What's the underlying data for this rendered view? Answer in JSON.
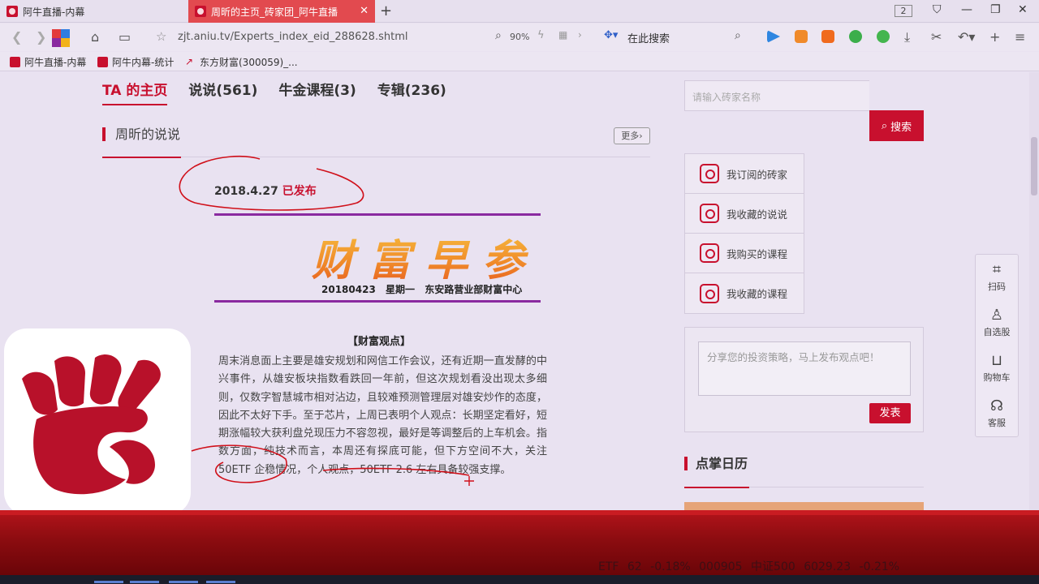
{
  "browser": {
    "tabs": [
      {
        "label": "阿牛直播-内幕",
        "active": false
      },
      {
        "label": "周昕的主页_砖家团_阿牛直播",
        "active": true
      }
    ],
    "tab_count": "2",
    "url": "zjt.aniu.tv/Experts_index_eid_288628.shtml",
    "zoom": "90%",
    "search_engine_label": "在此搜索",
    "bookmarks": [
      "阿牛直播-内幕",
      "阿牛内幕-统计",
      "东方财富(300059)_..."
    ]
  },
  "nav": {
    "tabs": [
      "TA 的主页",
      "说说(561)",
      "牛金课程(3)",
      "专辑(236)"
    ],
    "active_index": 0
  },
  "section": {
    "title": "周昕的说说",
    "more_label": "更多›"
  },
  "post": {
    "date": "2018.4.27",
    "status": "已发布",
    "banner_title": "财富早参",
    "banner_date": "20180423",
    "banner_weekday": "星期一",
    "banner_org": "东安路营业部财富中心",
    "viewpoint_title": "【财富观点】",
    "body": "周末消息面上主要是雄安规划和网信工作会议，还有近期一直发酵的中兴事件，从雄安板块指数看跌回一年前，但这次规划看没出现太多细则，仅数字智慧城市相对沾边，且较难预测管理层对雄安炒作的态度，因此不太好下手。至于芯片，上周已表明个人观点：长期坚定看好，短期涨幅较大获利盘兑现压力不容忽视，最好是等调整后的上车机会。指数方面，纯技术而言，本周还有探底可能，但下方空间不大，关注50ETF 企稳情况，个人观点，50ETF 2.6 左右具备较强支撑。"
  },
  "sidebar": {
    "search_placeholder": "请输入砖家名称",
    "search_button": "搜索",
    "menu": [
      "我订阅的砖家",
      "我收藏的说说",
      "我购买的课程",
      "我收藏的课程"
    ],
    "share_placeholder": "分享您的投资策略，马上发布观点吧！",
    "publish_button": "发表",
    "calendar_title": "点掌日历"
  },
  "float_bar": {
    "items": [
      {
        "label": "扫码",
        "icon": "qr-code-icon"
      },
      {
        "label": "自选股",
        "icon": "user-icon"
      },
      {
        "label": "购物车",
        "icon": "cart-icon"
      },
      {
        "label": "客服",
        "icon": "headset-icon"
      }
    ]
  },
  "ticker": {
    "text": "ETF 62  -0.18%  000905 中证500  6029.23 -0.21%"
  },
  "colors": {
    "accent": "#c8102e",
    "banner_line": "#8a2aa0",
    "tab_active": "#e24a4f"
  }
}
